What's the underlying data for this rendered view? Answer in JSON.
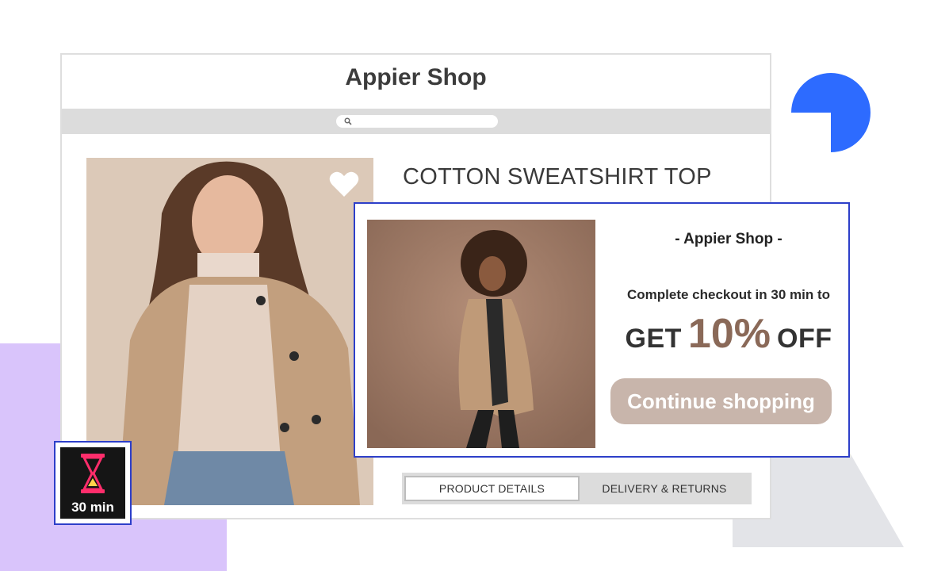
{
  "window": {
    "shop_title": "Appier Shop",
    "search": {
      "placeholder": ""
    }
  },
  "product": {
    "title": "COTTON SWEATSHIRT TOP",
    "favorite_icon": "heart-icon"
  },
  "tabs": [
    {
      "label": "PRODUCT DETAILS",
      "active": true
    },
    {
      "label": "DELIVERY & RETURNS",
      "active": false
    }
  ],
  "popup": {
    "shop_label": "- Appier Shop -",
    "subtitle": "Complete checkout in 30 min to",
    "offer_prefix": "GET",
    "offer_value": "10%",
    "offer_suffix": "OFF",
    "button_label": "Continue shopping"
  },
  "timer": {
    "icon": "hourglass-icon",
    "label": "30 min"
  },
  "colors": {
    "accent_blue": "#2d6bff",
    "popup_border": "#2d3fc9",
    "offer_brown": "#8a6958",
    "button_bg": "#c8b5ab",
    "bg_purple": "#d9c4fb"
  }
}
